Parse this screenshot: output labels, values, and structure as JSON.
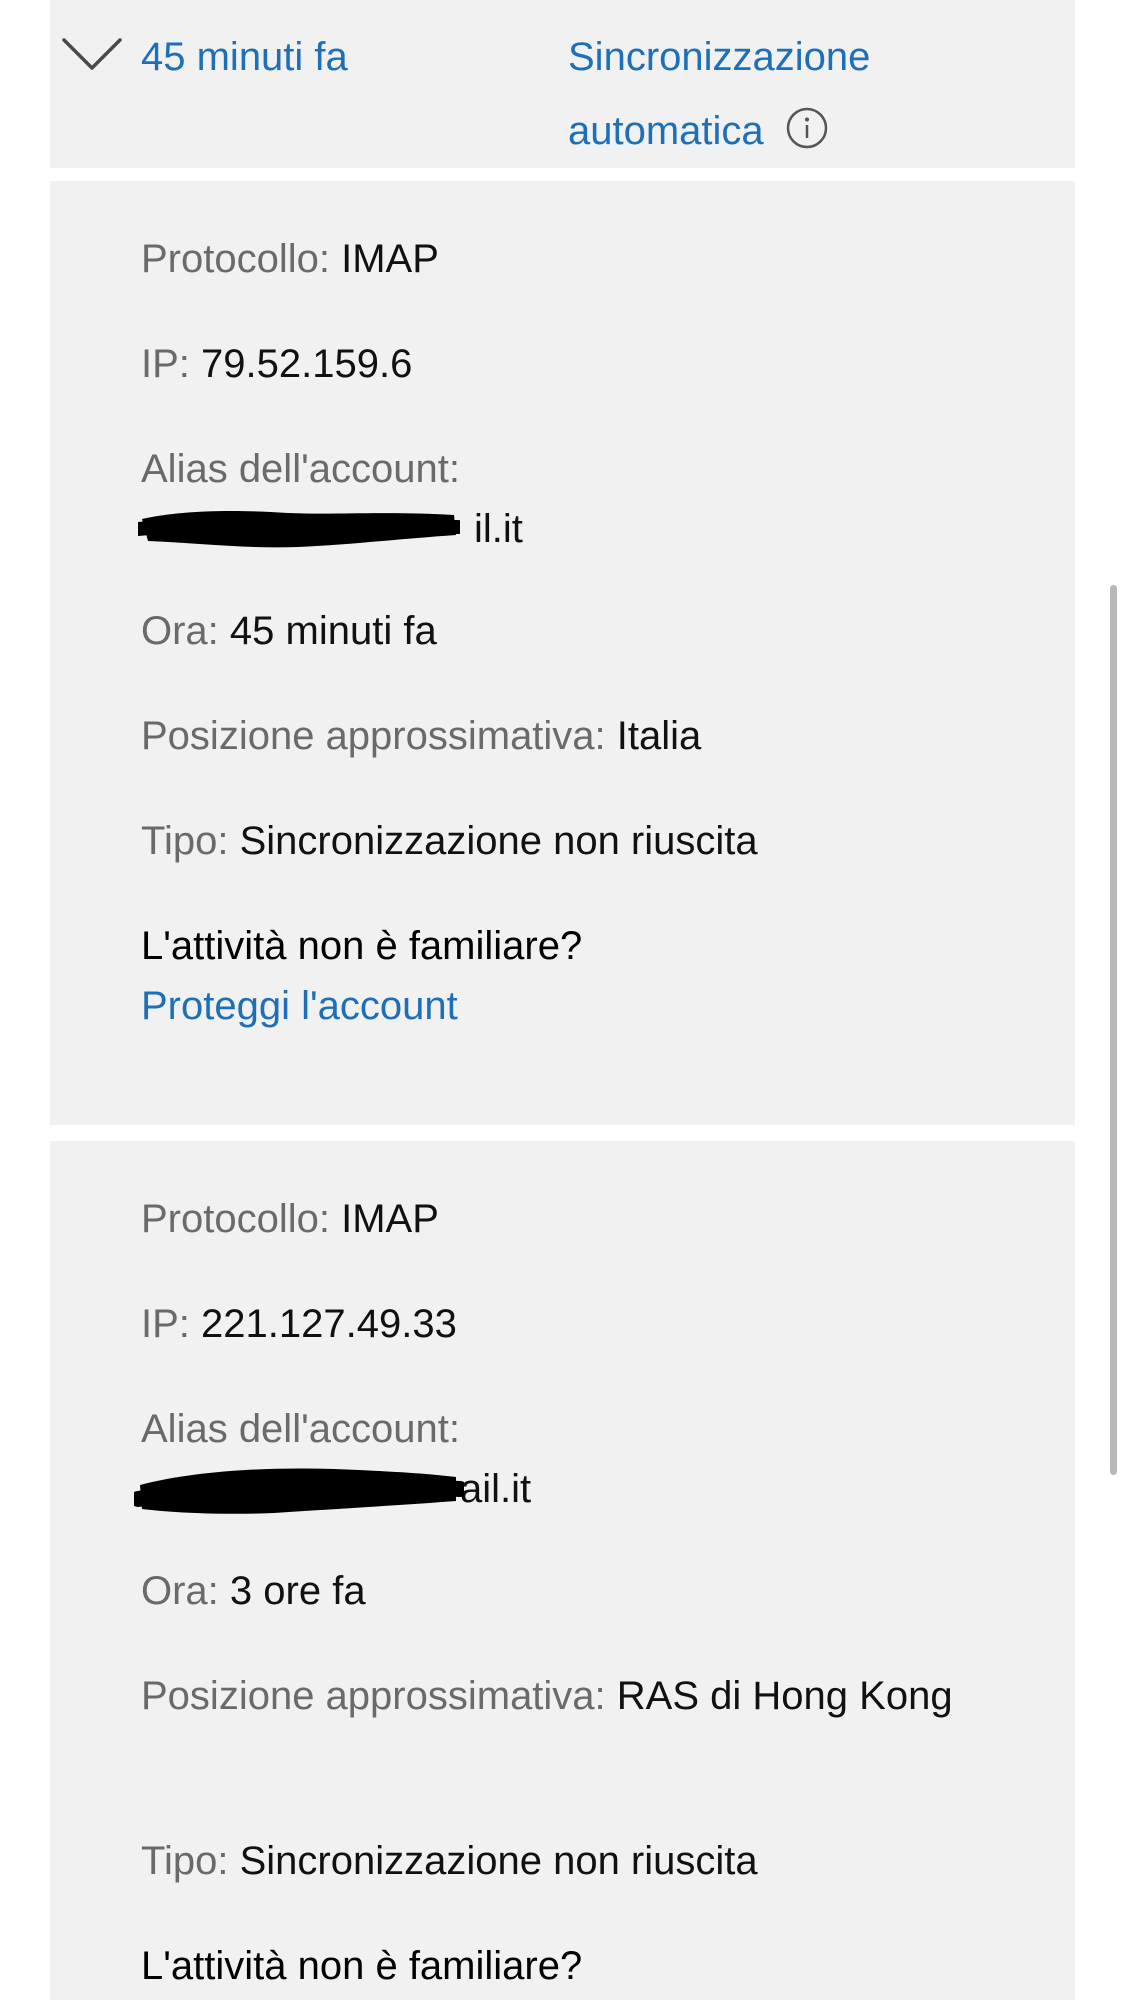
{
  "header": {
    "time": "45 minuti fa",
    "type": "Sincronizzazione automatica"
  },
  "labels": {
    "protocol": "Protocollo:",
    "ip": "IP:",
    "alias": "Alias dell'account:",
    "time": "Ora:",
    "location": "Posizione approssimativa:",
    "type": "Tipo:",
    "unfamiliar": "L'attività non è familiare?",
    "protect_link": "Proteggi l'account"
  },
  "events": [
    {
      "protocol": "IMAP",
      "ip": "79.52.159.6",
      "alias_visible_end": "il.it",
      "time": "45 minuti fa",
      "location": "Italia",
      "type": "Sincronizzazione non riuscita"
    },
    {
      "protocol": "IMAP",
      "ip": "221.127.49.33",
      "alias_visible_end": "ail.it",
      "time": "3 ore fa",
      "location": "RAS di Hong Kong",
      "type": "Sincronizzazione non riuscita"
    }
  ],
  "colors": {
    "link": "#1d6fb8",
    "card_background": "#f1f1f2",
    "label_gray": "#6a6a6a"
  },
  "icons": [
    "chevron-down-icon",
    "info-icon"
  ]
}
